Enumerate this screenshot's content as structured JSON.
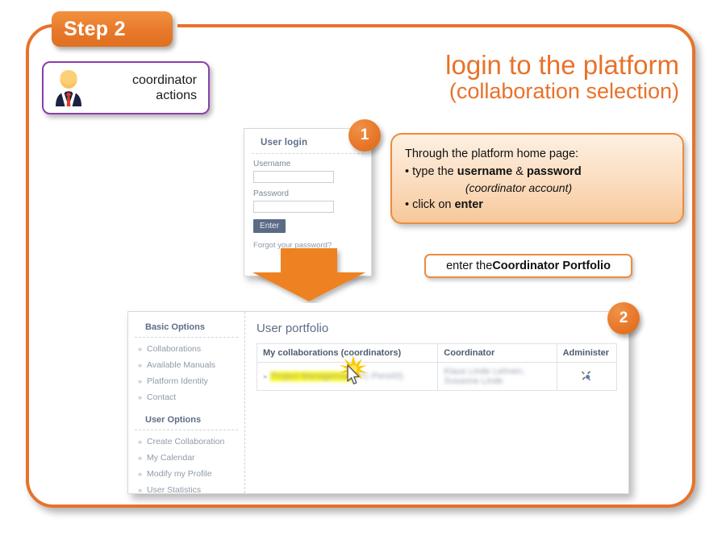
{
  "slide": {
    "step_tab_label": "Step 2",
    "accent_orange": "#E8722A",
    "purple_border": "#8B3FA8",
    "heading_line1": "login to the platform",
    "heading_line2": "(collaboration selection)"
  },
  "actor": {
    "label_line1": "coordinator",
    "label_line2": "actions",
    "icon": "businessperson-avatar-icon"
  },
  "badges": {
    "one": "1",
    "two": "2"
  },
  "login_card": {
    "title": "User login",
    "username_label": "Username",
    "username_value": "",
    "password_label": "Password",
    "password_value": "",
    "enter_button": "Enter",
    "forgot_link": "Forgot your password?"
  },
  "callout": {
    "intro": "Through the platform home page:",
    "bullet1_prefix": "• type the ",
    "bullet1_bold1": "username",
    "bullet1_mid": " & ",
    "bullet1_bold2": "password",
    "bullet1_sub": "(coordinator account)",
    "bullet2_prefix": "• click on ",
    "bullet2_bold": "enter"
  },
  "portfolio_button": {
    "prefix": "enter the ",
    "bold": "Coordinator Portfolio"
  },
  "app": {
    "title": "User portfolio",
    "sidebar": {
      "group1_title": "Basic Options",
      "group1_items": [
        "Collaborations",
        "Available Manuals",
        "Platform Identity",
        "Contact"
      ],
      "group2_title": "User Options",
      "group2_items": [
        "Create Collaboration",
        "My Calendar",
        "Modify my Profile",
        "User Statistics"
      ],
      "chevron": "»"
    },
    "table": {
      "headers": [
        "My collaborations (coordinators)",
        "Coordinator",
        "Administer"
      ],
      "row_chevron": "»",
      "row": {
        "collaboration_highlighted": "Project Management",
        "collaboration_rest": " (PC-Pers00)",
        "coordinator": "Klaus Linde Lehnen, Susanne Linde",
        "administer_icon": "tools-wrench-screwdriver-icon"
      }
    }
  }
}
